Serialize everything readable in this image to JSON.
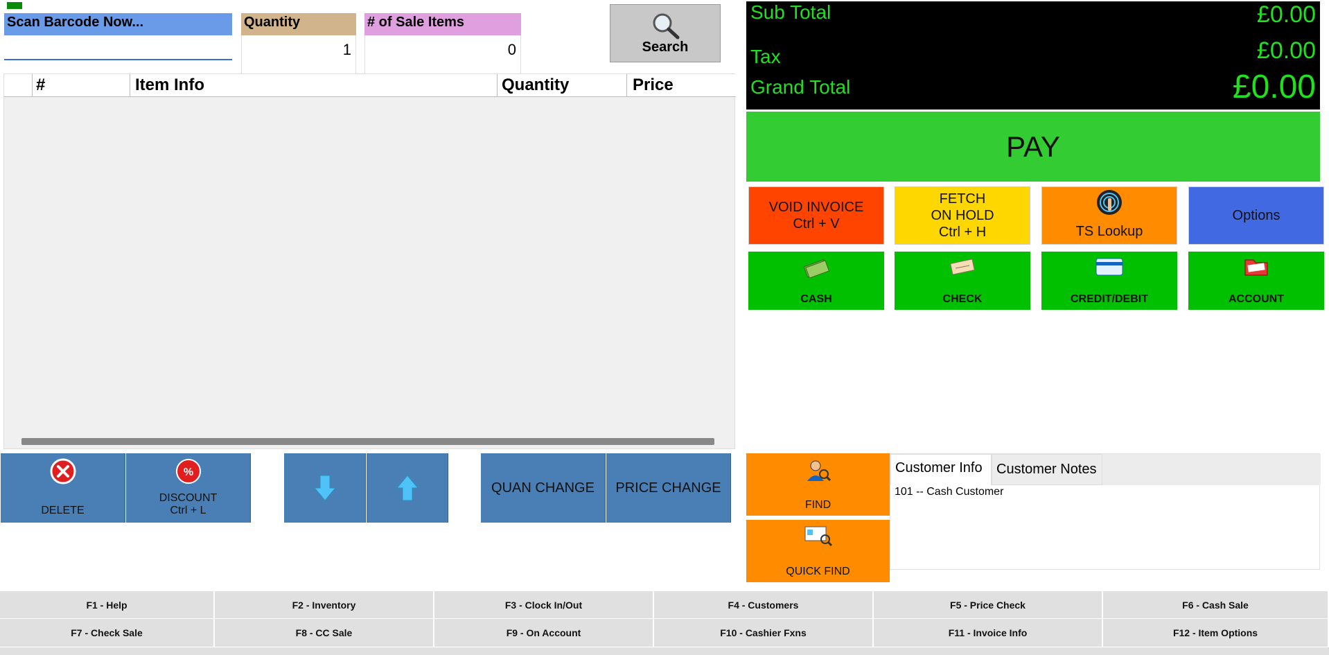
{
  "barcode": {
    "label": "Scan Barcode Now...",
    "value": ""
  },
  "quantity": {
    "label": "Quantity",
    "value": "1"
  },
  "sale_items": {
    "label": "# of Sale Items",
    "value": "0"
  },
  "search": {
    "label": "Search"
  },
  "grid": {
    "columns": [
      "#",
      "Item Info",
      "Quantity",
      "Price"
    ]
  },
  "totals": {
    "subtotal_label": "Sub Total",
    "subtotal_value": "£0.00",
    "tax_label": "Tax",
    "tax_value": "£0.00",
    "grand_label": "Grand Total",
    "grand_value": "£0.00"
  },
  "pay": {
    "label": "PAY"
  },
  "actions": {
    "void": "VOID INVOICE\nCtrl + V",
    "fetch": "FETCH\nON HOLD\nCtrl + H",
    "ts_lookup": "TS Lookup",
    "options": "Options"
  },
  "tenders": {
    "cash": "CASH",
    "check": "CHECK",
    "credit": "CREDIT/DEBIT",
    "account": "ACCOUNT"
  },
  "item_buttons": {
    "delete": "DELETE",
    "discount": "DISCOUNT\nCtrl + L",
    "quan_change": "QUAN CHANGE",
    "price_change": "PRICE CHANGE"
  },
  "customer": {
    "find": "FIND",
    "quick_find": "QUICK FIND",
    "tab_info": "Customer Info",
    "tab_notes": "Customer Notes",
    "current": "101 -- Cash Customer"
  },
  "fkeys": [
    "F1 - Help",
    "F2 - Inventory",
    "F3 - Clock In/Out",
    "F4 - Customers",
    "F5 - Price Check",
    "F6 - Cash Sale",
    "F7 - Check Sale",
    "F8 - CC Sale",
    "F9 - On Account",
    "F10 - Cashier Fxns",
    "F11 - Invoice Info",
    "F12 - Item Options"
  ],
  "colors": {
    "pay": "#33cc33",
    "void": "#ff4400",
    "fetch": "#ffd700",
    "ts": "#ff8c00",
    "options": "#4169e1",
    "tender": "#00c000",
    "item_btn": "#4a7fb5",
    "find": "#ff8c00",
    "totals_bg": "#000000",
    "totals_fg": "#20e020"
  }
}
